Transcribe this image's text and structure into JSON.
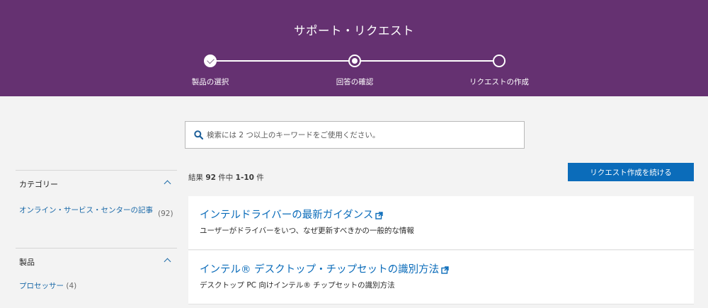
{
  "header": {
    "title": "サポート・リクエスト",
    "steps": [
      {
        "label": "製品の選択",
        "state": "completed"
      },
      {
        "label": "回答の確認",
        "state": "current"
      },
      {
        "label": "リクエストの作成",
        "state": "upcoming"
      }
    ]
  },
  "search": {
    "placeholder": "検索には 2 つ以上のキーワードをご使用ください。",
    "icon": "search-icon"
  },
  "filters": [
    {
      "title": "カテゴリー",
      "items": [
        {
          "label": "オンライン・サービス・センターの記事",
          "count": "(92)"
        }
      ]
    },
    {
      "title": "製品",
      "items": [
        {
          "label": "プロセッサー",
          "count": "(4)"
        }
      ]
    }
  ],
  "results": {
    "prefix": "結果 ",
    "total": "92",
    "middle": " 件中 ",
    "range": "1-10",
    "suffix": " 件"
  },
  "continue_button": "リクエスト作成を続ける",
  "articles": [
    {
      "title": "インテルドライバーの最新ガイダンス",
      "description": "ユーザーがドライバーをいつ、なぜ更新すべきかの一般的な情報"
    },
    {
      "title": "インテル® デスクトップ・チップセットの識別方法",
      "description": "デスクトップ PC 向けインテル® チップセットの識別方法"
    }
  ],
  "colors": {
    "header_bg": "#653171",
    "accent": "#0b6cba",
    "link": "#1a69a8"
  }
}
